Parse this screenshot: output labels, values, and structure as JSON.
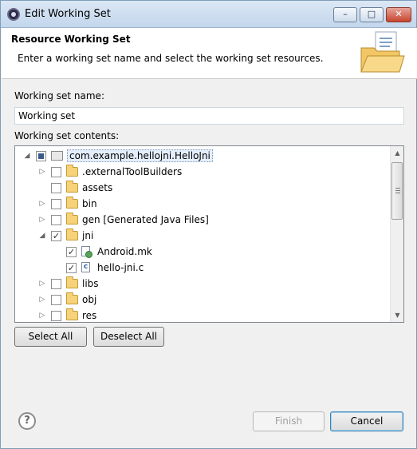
{
  "window": {
    "title": "Edit Working Set",
    "icon": "eclipse-icon",
    "controls": {
      "minimize": "–",
      "maximize": "□",
      "close": "✕"
    }
  },
  "banner": {
    "title": "Resource Working Set",
    "description": "Enter a working set name and select the working set resources.",
    "icon": "folder-document-icon"
  },
  "form": {
    "name_label": "Working set name:",
    "name_value": "Working set",
    "contents_label": "Working set contents:"
  },
  "tree": {
    "items": [
      {
        "label": "com.example.hellojni.HelloJni",
        "depth": 0,
        "expanded": true,
        "check": "partial",
        "icon": "project-icon",
        "selected": true
      },
      {
        "label": ".externalToolBuilders",
        "depth": 1,
        "expanded": false,
        "check": "unchecked",
        "icon": "folder-icon"
      },
      {
        "label": "assets",
        "depth": 1,
        "expanded": null,
        "check": "unchecked",
        "icon": "folder-icon"
      },
      {
        "label": "bin",
        "depth": 1,
        "expanded": false,
        "check": "unchecked",
        "icon": "folder-icon"
      },
      {
        "label": "gen [Generated Java Files]",
        "depth": 1,
        "expanded": false,
        "check": "unchecked",
        "icon": "folder-icon"
      },
      {
        "label": "jni",
        "depth": 1,
        "expanded": true,
        "check": "checked",
        "icon": "folder-icon"
      },
      {
        "label": "Android.mk",
        "depth": 2,
        "expanded": null,
        "check": "checked",
        "icon": "file-icon"
      },
      {
        "label": "hello-jni.c",
        "depth": 2,
        "expanded": null,
        "check": "checked",
        "icon": "c-file-icon"
      },
      {
        "label": "libs",
        "depth": 1,
        "expanded": false,
        "check": "unchecked",
        "icon": "folder-icon"
      },
      {
        "label": "obj",
        "depth": 1,
        "expanded": false,
        "check": "unchecked",
        "icon": "folder-icon"
      },
      {
        "label": "res",
        "depth": 1,
        "expanded": false,
        "check": "unchecked",
        "icon": "folder-icon"
      }
    ]
  },
  "buttons": {
    "select_all": "Select All",
    "deselect_all": "Deselect All",
    "finish": "Finish",
    "cancel": "Cancel",
    "help": "?"
  }
}
